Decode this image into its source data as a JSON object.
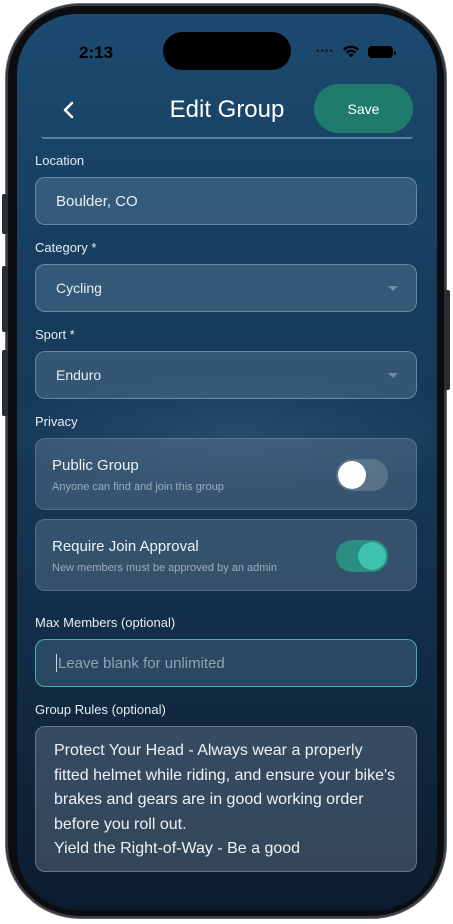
{
  "status_bar": {
    "time": "2:13"
  },
  "header": {
    "title": "Edit Group",
    "back_icon": "chevron-left-icon",
    "save_label": "Save"
  },
  "location": {
    "label": "Location",
    "value": "Boulder, CO"
  },
  "category": {
    "label": "Category *",
    "value": "Cycling"
  },
  "sport": {
    "label": "Sport *",
    "value": "Enduro"
  },
  "privacy": {
    "label": "Privacy",
    "public_group": {
      "title": "Public Group",
      "subtitle": "Anyone can find and join this group",
      "enabled": false
    },
    "require_approval": {
      "title": "Require Join Approval",
      "subtitle": "New members must be approved by an admin",
      "enabled": true
    }
  },
  "max_members": {
    "label": "Max Members (optional)",
    "value": "",
    "placeholder": "Leave blank for unlimited"
  },
  "group_rules": {
    "label": "Group Rules (optional)",
    "value": "Protect Your Head - Always wear a properly fitted helmet while riding, and ensure your bike's brakes and gears are in good working order before you roll out.\nYield the Right-of-Way - Be a good"
  },
  "colors": {
    "accent": "#1f7b6c",
    "toggle_on": "#3ec2ad",
    "focus_border": "#3fb4a4",
    "background_top": "#1c4a70",
    "background_bottom": "#0c1c2d"
  }
}
